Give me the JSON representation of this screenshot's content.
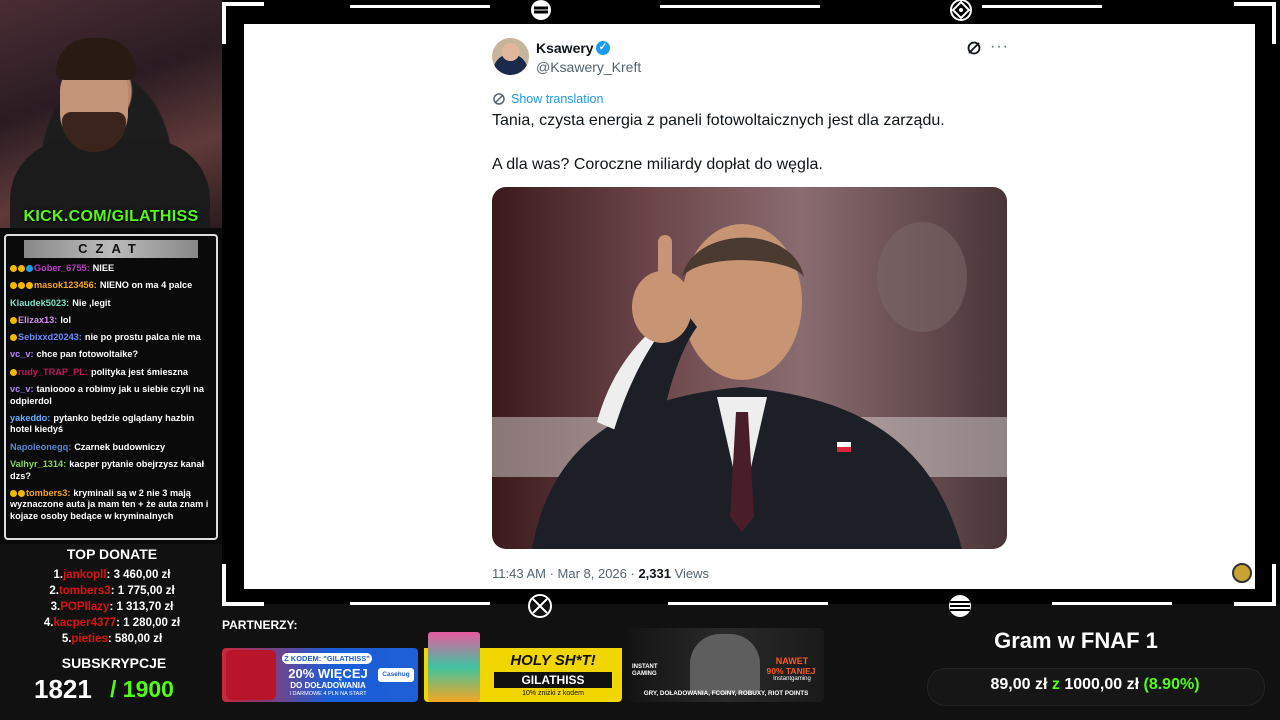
{
  "webcam": {
    "kick_url": "KICK.COM/GILATHISS"
  },
  "chat": {
    "title": "CZAT",
    "messages": [
      {
        "user": "Gober_6755:",
        "text": "NIEE",
        "color": "#c03acb",
        "badges": [
          "#f5b800",
          "#f5b800",
          "#1d9bf0"
        ]
      },
      {
        "user": "masok123456:",
        "text": "NIENO on ma 4 palce",
        "color": "#f5a623",
        "badges": [
          "#f5b800",
          "#f5b800",
          "#f5b800"
        ]
      },
      {
        "user": "Klaudek5023:",
        "text": "Nie ,legit",
        "color": "#7ee0c7",
        "badges": []
      },
      {
        "user": "Elizax13:",
        "text": "lol",
        "color": "#d48ef0",
        "badges": [
          "#f5b800"
        ]
      },
      {
        "user": "Sebixxd20243:",
        "text": "nie po prostu palca nie ma",
        "color": "#6b8cff",
        "badges": [
          "#f5b800"
        ]
      },
      {
        "user": "vc_v:",
        "text": "chce pan fotowoltaike?",
        "color": "#b388ff",
        "badges": []
      },
      {
        "user": "rudy_TRAP_PL:",
        "text": "polityka jest śmieszna",
        "color": "#c2185b",
        "badges": [
          "#f5b800"
        ]
      },
      {
        "user": "vc_v:",
        "text": "tanioooo a robimy jak u siebie czyli na odpierdol",
        "color": "#b388ff",
        "badges": []
      },
      {
        "user": "yakeddo:",
        "text": "pytanko będzie oglądany hazbin hotel kiedyś",
        "color": "#5fb0ff",
        "badges": []
      },
      {
        "user": "Napoleonegq:",
        "text": "Czarnek budowniczy",
        "color": "#5a86d6",
        "badges": []
      },
      {
        "user": "Valhyr_1314:",
        "text": "kacper pytanie obejrzysz kanał dzs?",
        "color": "#8bd35a",
        "badges": []
      },
      {
        "user": "tombers3:",
        "text": "kryminali są w 2 nie 3 mają wyznaczone auta ja mam ten + że auta znam i kojaze osoby bedące w kryminalnych",
        "color": "#f5a623",
        "badges": [
          "#f5b800",
          "#f5b800"
        ]
      }
    ]
  },
  "top_donate": {
    "title": "TOP DONATE",
    "entries": [
      {
        "rank": "1.",
        "user": "jankopll",
        "amount": ": 3 460,00 zł"
      },
      {
        "rank": "2.",
        "user": "tombers3",
        "amount": ": 1 775,00 zł"
      },
      {
        "rank": "3.",
        "user": "POPIlazy",
        "amount": ": 1 313,70 zł"
      },
      {
        "rank": "4.",
        "user": "kacper4377",
        "amount": ": 1 280,00 zł"
      },
      {
        "rank": "5.",
        "user": "pieties",
        "amount": ": 580,00 zł"
      }
    ]
  },
  "subs": {
    "title": "SUBSKRYPCJE",
    "count": "1821",
    "goal": "/ 1900"
  },
  "tweet": {
    "name": "Ksawery",
    "handle": "@Ksawery_Kreft",
    "show_translation": "Show translation",
    "text1": "Tania, czysta energia z paneli fotowoltaicznych jest dla zarządu.",
    "text2": "A dla was? Coroczne miliardy dopłat do węgla.",
    "time": "11:43 AM · Mar 8, 2026 · ",
    "views_num": "2,331",
    "views_label": " Views"
  },
  "partners": {
    "label": "PARTNERZY:",
    "casehug": {
      "kod": "Z KODEM: \"GILATHISS\"",
      "main": "20% WIĘCEJ",
      "sub": "DO DOŁADOWANIA",
      "small": "I DARMOWE 4 PLN NA START",
      "brand": "Casehug"
    },
    "holyshot": {
      "main": "HOLY SH*T!",
      "code": "GILATHISS",
      "small": "10% zniżki z kodem"
    },
    "instant": {
      "brand": "INSTANT GAMING",
      "nawet": "NAWET",
      "pct": "90% TANIEJ",
      "site": "Instantgaming",
      "bottom": "GRY, DOŁADOWANIA, FCOINY, ROBUXY, RIOT POINTS"
    }
  },
  "goal": {
    "title": "Gram w FNAF 1",
    "current": "89,00 zł",
    "sep": "z",
    "target": "1000,00 zł",
    "percent": "(8.90%)"
  }
}
